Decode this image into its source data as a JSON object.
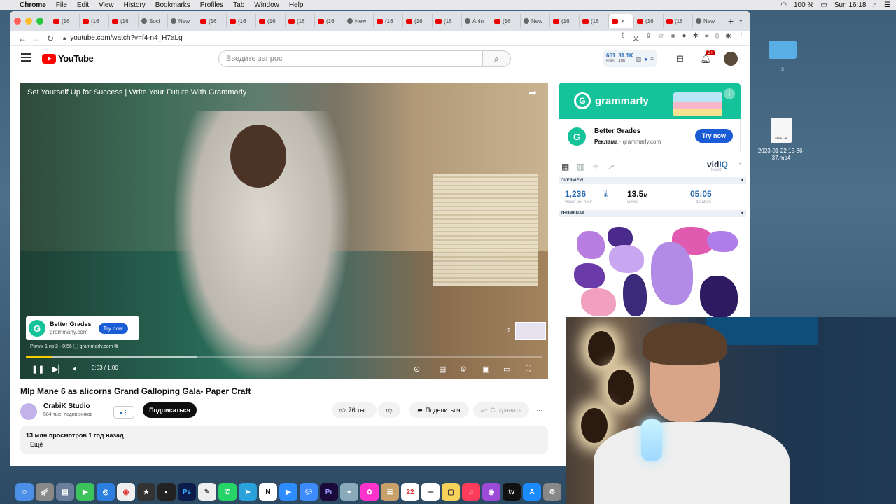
{
  "menubar": {
    "app": "Chrome",
    "items": [
      "File",
      "Edit",
      "View",
      "History",
      "Bookmarks",
      "Profiles",
      "Tab",
      "Window",
      "Help"
    ],
    "battery": "100 %",
    "clock": "Sun 16:18"
  },
  "desktop": {
    "folder_label": "з",
    "file_badge": "MPEG4",
    "file_label": "2023-01-22 15-36-37.mp4"
  },
  "browser": {
    "tabs": [
      {
        "label": "(16",
        "icon": "youtube-icon"
      },
      {
        "label": "(16",
        "icon": "youtube-icon"
      },
      {
        "label": "(16",
        "icon": "youtube-icon"
      },
      {
        "label": "Soci",
        "icon": "chart-icon"
      },
      {
        "label": "New",
        "icon": "globe-icon"
      },
      {
        "label": "(16",
        "icon": "youtube-icon"
      },
      {
        "label": "(16",
        "icon": "youtube-icon"
      },
      {
        "label": "(16",
        "icon": "youtube-icon"
      },
      {
        "label": "(16",
        "icon": "youtube-icon"
      },
      {
        "label": "(16",
        "icon": "youtube-icon"
      },
      {
        "label": "New",
        "icon": "globe-icon"
      },
      {
        "label": "(16",
        "icon": "youtube-icon"
      },
      {
        "label": "(16",
        "icon": "youtube-icon"
      },
      {
        "label": "(16",
        "icon": "youtube-icon"
      },
      {
        "label": "Anin",
        "icon": "chart-icon"
      },
      {
        "label": "(16",
        "icon": "youtube-icon"
      },
      {
        "label": "New",
        "icon": "globe-icon"
      },
      {
        "label": "(16",
        "icon": "youtube-icon"
      },
      {
        "label": "(16",
        "icon": "youtube-icon"
      }
    ],
    "active_tab_icon": "youtube-icon",
    "tabs_after": [
      {
        "label": "(16",
        "icon": "youtube-icon"
      },
      {
        "label": "(16",
        "icon": "youtube-icon"
      },
      {
        "label": "New",
        "icon": "globe-icon"
      }
    ],
    "url": "youtube.com/watch?v=f4-n4_H7aLg"
  },
  "youtube": {
    "logo_text": "YouTube",
    "search_placeholder": "Введите запрос",
    "vidiq": {
      "n1": "661",
      "s1": "60m",
      "n2": "31.1K",
      "s2": "48h"
    },
    "notif_badge": "9+",
    "player": {
      "video_title": "Set Yourself Up for Success | Write Your Future With Grammarly",
      "ad_title": "Better Grades",
      "ad_domain": "grammarly.com",
      "ad_cta": "Try now",
      "ad_info": "Ролик 1 из 2 · 0:56",
      "ad_info_domain": "grammarly.com",
      "next_count": "2",
      "time": "0:03 / 1:00",
      "progress": 0.05,
      "buffered": 0.33
    },
    "video": {
      "title": "Mlp Mane 6 as alicorns Grand Galloping Gala- Paper Craft",
      "channel": "CrabiK Studio",
      "subscribers": "584 тыс. подписчиков",
      "subscribe": "Подписаться",
      "likes": "76 тыс.",
      "share": "Поделиться",
      "save": "Сохранить",
      "views_date": "13 млн просмотров  1 год назад",
      "more": "Ещё"
    },
    "sidebar_ad": {
      "brand": "grammarly",
      "title": "Better Grades",
      "label": "Реклама",
      "domain": "grammarly.com",
      "cta": "Try now"
    },
    "vidiq_panel": {
      "logo_a": "vid",
      "logo_b": "IQ",
      "boost": "boost",
      "overview": "OVERVIEW",
      "views_hour": "1,236",
      "views_hour_label": "views per hour",
      "views": "13.5",
      "views_unit": "м",
      "views_label": "views",
      "duration": "05:05",
      "duration_label": "duration",
      "thumbnail": "THUMBNAIL"
    }
  }
}
